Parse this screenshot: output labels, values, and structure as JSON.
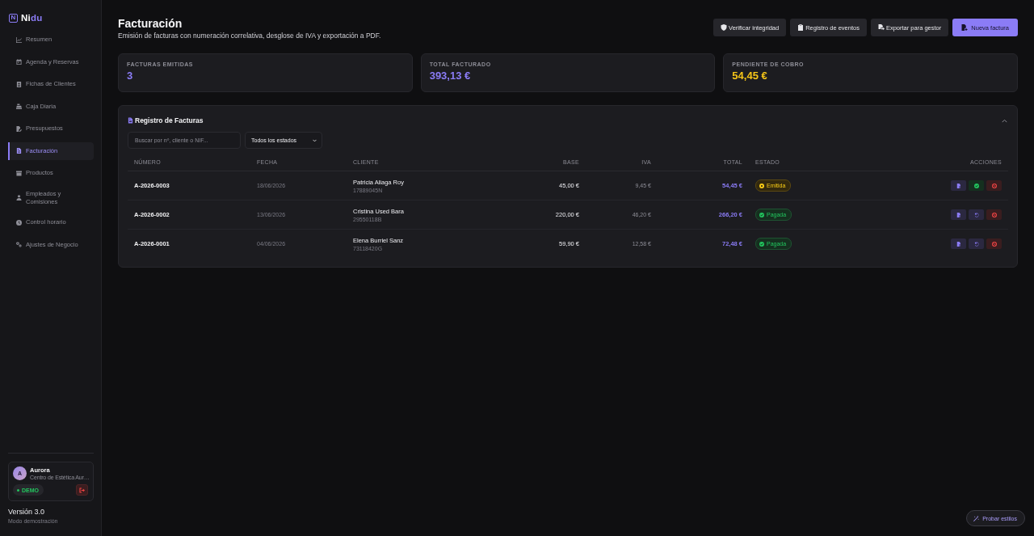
{
  "sidebar": {
    "logo": {
      "mark": "N",
      "parts": [
        "Ni",
        "du"
      ]
    },
    "items": [
      {
        "label": "Resumen",
        "selected": false
      },
      {
        "label": "Agenda y Reservas",
        "selected": false
      },
      {
        "label": "Fichas de Clientes",
        "selected": false
      },
      {
        "label": "Caja Diaria",
        "selected": false
      },
      {
        "label": "Presupuestos",
        "selected": false
      },
      {
        "label": "Facturación",
        "selected": true
      },
      {
        "label": "Productos",
        "selected": false
      },
      {
        "label": "Empleados y Comisiones",
        "selected": false
      },
      {
        "label": "Control horario",
        "selected": false
      },
      {
        "label": "Ajustes de Negocio",
        "selected": false
      }
    ],
    "user": {
      "initial": "A",
      "name": "Aurora",
      "business": "Centro de Estética Aur…",
      "badge": "DEMO"
    },
    "version": "Versión 3.0",
    "mode": "Modo demostración"
  },
  "header": {
    "title": "Facturación",
    "subtitle": "Emisión de facturas con numeración correlativa, desglose de IVA y exportación a PDF.",
    "buttons": [
      {
        "label": "Verificar integridad",
        "kind": "secondary"
      },
      {
        "label": "Registro de eventos",
        "kind": "secondary"
      },
      {
        "label": "Exportar para gestor",
        "kind": "secondary"
      },
      {
        "label": "Nueva factura",
        "kind": "primary"
      }
    ]
  },
  "stats": [
    {
      "label": "FACTURAS EMITIDAS",
      "value": "3",
      "kind": "accent"
    },
    {
      "label": "TOTAL FACTURADO",
      "value": "393,13 €",
      "kind": "accent"
    },
    {
      "label": "PENDIENTE DE COBRO",
      "value": "54,45 €",
      "kind": "warning"
    }
  ],
  "invoices_panel": {
    "title": "Registro de Facturas",
    "expanded": true,
    "search": {
      "placeholder": "Buscar por nº, cliente o NIF..."
    },
    "status_filter": {
      "value": "Todos los estados"
    },
    "table": {
      "columns": [
        "NÚMERO",
        "FECHA",
        "CLIENTE",
        "BASE",
        "IVA",
        "TOTAL",
        "ESTADO",
        "ACCIONES"
      ],
      "rows": [
        {
          "number": "A-2026-0003",
          "date": "18/06/2026",
          "client": "Patricia Aliaga Roy",
          "nif": "17889045N",
          "base": "45,00 €",
          "iva": "9,45 €",
          "total": "54,45 €",
          "status": {
            "label": "Emitida",
            "kind": "issued"
          },
          "actions": [
            {
              "kind": "pdf"
            },
            {
              "kind": "mark-paid"
            },
            {
              "kind": "cancel"
            }
          ]
        },
        {
          "number": "A-2026-0002",
          "date": "13/06/2026",
          "client": "Cristina Used Bara",
          "nif": "29550118B",
          "base": "220,00 €",
          "iva": "46,20 €",
          "total": "266,20 €",
          "status": {
            "label": "Pagada",
            "kind": "paid"
          },
          "actions": [
            {
              "kind": "pdf"
            },
            {
              "kind": "revert"
            },
            {
              "kind": "cancel"
            }
          ]
        },
        {
          "number": "A-2026-0001",
          "date": "04/06/2026",
          "client": "Elena Burriel Sanz",
          "nif": "73118420G",
          "base": "59,90 €",
          "iva": "12,58 €",
          "total": "72,48 €",
          "status": {
            "label": "Pagada",
            "kind": "paid"
          },
          "actions": [
            {
              "kind": "pdf"
            },
            {
              "kind": "revert"
            },
            {
              "kind": "cancel"
            }
          ]
        }
      ]
    }
  },
  "style_button": {
    "label": "Probar estilos"
  }
}
